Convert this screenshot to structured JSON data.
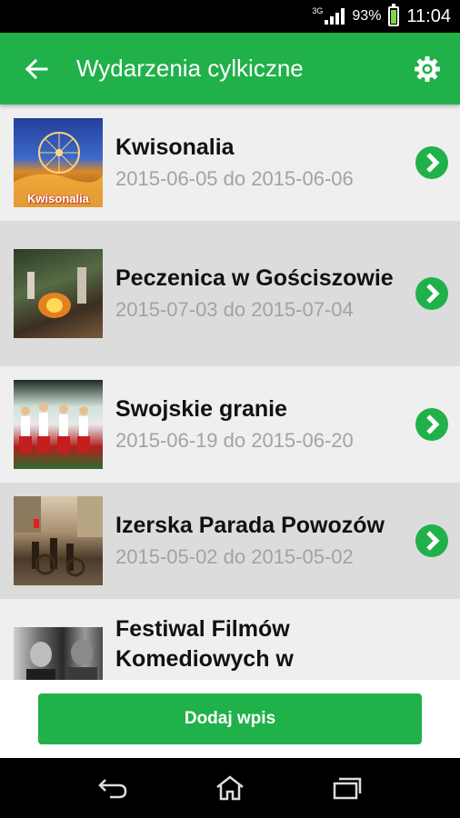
{
  "status_bar": {
    "network": "3G",
    "battery_percent": "93%",
    "battery_level": 0.93,
    "time": "11:04"
  },
  "app_bar": {
    "title": "Wydarzenia cylkiczne",
    "back_icon": "arrow-back-icon",
    "settings_icon": "gear-icon",
    "color": "#20b14a"
  },
  "events": [
    {
      "title": "Kwisonalia",
      "date": "2015-06-05 do 2015-06-06",
      "thumb_text": "Kwisonalia"
    },
    {
      "title": "Peczenica w Gościszowie",
      "date": "2015-07-03 do 2015-07-04"
    },
    {
      "title": "Swojskie granie",
      "date": "2015-06-19 do 2015-06-20"
    },
    {
      "title": "Izerska Parada Powozów",
      "date": "2015-05-02 do 2015-05-02"
    },
    {
      "title": "Festiwal Filmów Komediowych w",
      "date": ""
    }
  ],
  "footer": {
    "add_button": "Dodaj wpis"
  },
  "nav_bar": {
    "back": "back-icon",
    "home": "home-icon",
    "recents": "recents-icon"
  }
}
